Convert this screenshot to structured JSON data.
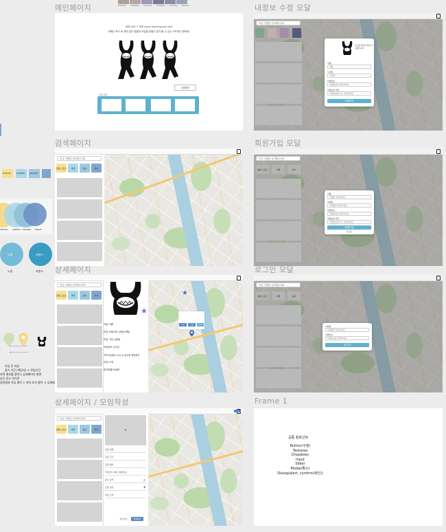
{
  "frames": {
    "main": "메인페이지",
    "profile_modal": "내정보 수정 모달",
    "search": "검색페이지",
    "signup_modal": "회원가입 모달",
    "detail": "상세페이지",
    "login_modal": "로그인 모달",
    "detail_create": "상세페이지 / 모임작성",
    "frame1": "Frame 1"
  },
  "palette": {
    "top_swatches": [
      "#a9a19a",
      "#b8a7a3",
      "#9a9bb6",
      "#7c7a98",
      "#8b8fa6",
      "#9aa3b5"
    ],
    "top_labels": [
      "#F9E79D",
      "#A8D8EA",
      "#AA96DA",
      "#FCBAD3",
      "#FFFFD2",
      "#E5F4FF"
    ],
    "swatch_colors": [
      "#f7e08f",
      "#a8d8ea",
      "#9dc8df",
      "#7fa6cf"
    ],
    "swatch_labels": [
      "#F9E79D",
      "#A8D8EA",
      "#9DC8DF",
      "#7FA6CF"
    ],
    "circle_colors": [
      "#f5d98c",
      "#a8d8ea",
      "#8dc0d6",
      "#6f93c3"
    ],
    "circle_labels": [
      "F9E79D",
      "A8D8EA",
      "9DC8DF",
      "7FA6CF"
    ],
    "big_circles": [
      "#74bcd6",
      "#3a9cc2"
    ],
    "big_circle_labels": [
      "노랑",
      "코랄스"
    ],
    "big_circle_captions": [
      "노랑",
      "코랄스"
    ],
    "accent": "#5fb1cf"
  },
  "main_page": {
    "hero_line1": "취미 LikE ㅋ 모임 party meeting jam now",
    "hero_line2": "개쩌는 축구 바 취미 같이 찾을까 모임을 만들고 참가 할 수 있는 오프라인 멘토링!",
    "cta_button": "시작하기",
    "grid_label": "추천 모임"
  },
  "profile_modal": {
    "mascot_caption": "프로필 이미지 변경 하시겠습니까",
    "fields": [
      "이름",
      "닉네임",
      "비밀번호",
      "비밀번호 확인"
    ],
    "placeholders": [
      "이름",
      "닉네임",
      "비밀번호를 입력하세요",
      "비밀번호를 다시 입력하세요"
    ],
    "submit": "수정하기",
    "swatches": [
      "#7fa58c",
      "#c3aeb4",
      "#a48eaa",
      "#55597f"
    ]
  },
  "search_page": {
    "search_placeholder": "모임 이름을 검색해주세요",
    "categories": [
      "운동·스포츠",
      "여행",
      "음식",
      "독서",
      "기타"
    ]
  },
  "signup_modal": {
    "fields": [
      "이름",
      "이메일",
      "비밀번호",
      "비밀번호 확인"
    ],
    "placeholders": [
      "이름을 입력하세요",
      "이메일을 입력하세요",
      "비밀번호를 입력하세요",
      "비밀번호를 다시 입력하세요"
    ],
    "submit": "회원가입",
    "secondary": "로그인"
  },
  "detail_page": {
    "info_rows": [
      "모임 이름",
      "모임 카테고리 (운동/여행)",
      "모임 기간 (날짜)",
      "모임장소 (주소)",
      "지역 모임장소 주소 or 장소와 장면위치",
      "모임 소개",
      "참석현황 8/8명"
    ],
    "map_popup_buttons": [
      "수정",
      "삭제",
      "참석"
    ],
    "side_notes": [
      "모임 후 리뷰",
      "참가 기간 (해당자) > 모임기간",
      "지역 결과를 클릭시 상세페이지 화면",
      "상단 장소 아이콘",
      "검색결과 모임 클릭 > 좌석 보기 클릭 시 상세페이지"
    ]
  },
  "login_modal": {
    "fields": [
      "이메일",
      "비밀번호"
    ],
    "placeholders": [
      "이메일을 입력하세요",
      "비밀번호를 입력하세요"
    ],
    "submit": "로그인"
  },
  "detail_create": {
    "image_placeholder": "+",
    "form_rows": [
      "모임 이름",
      "모임 기간",
      "모임 날짜",
      "카테고리 선택 (드롭다운)",
      "장소 검색",
      "모임 인원",
      "모임 소개"
    ],
    "cancel": "취소하기",
    "submit": "작성하기"
  },
  "frame1": {
    "title": "공통 컴포넌트",
    "items": [
      "Button(수정)",
      "Textarea",
      "Dropdown",
      "Input",
      "Slider",
      "Modal(확시)",
      "Dialog(alert, confirm(화인))"
    ]
  }
}
